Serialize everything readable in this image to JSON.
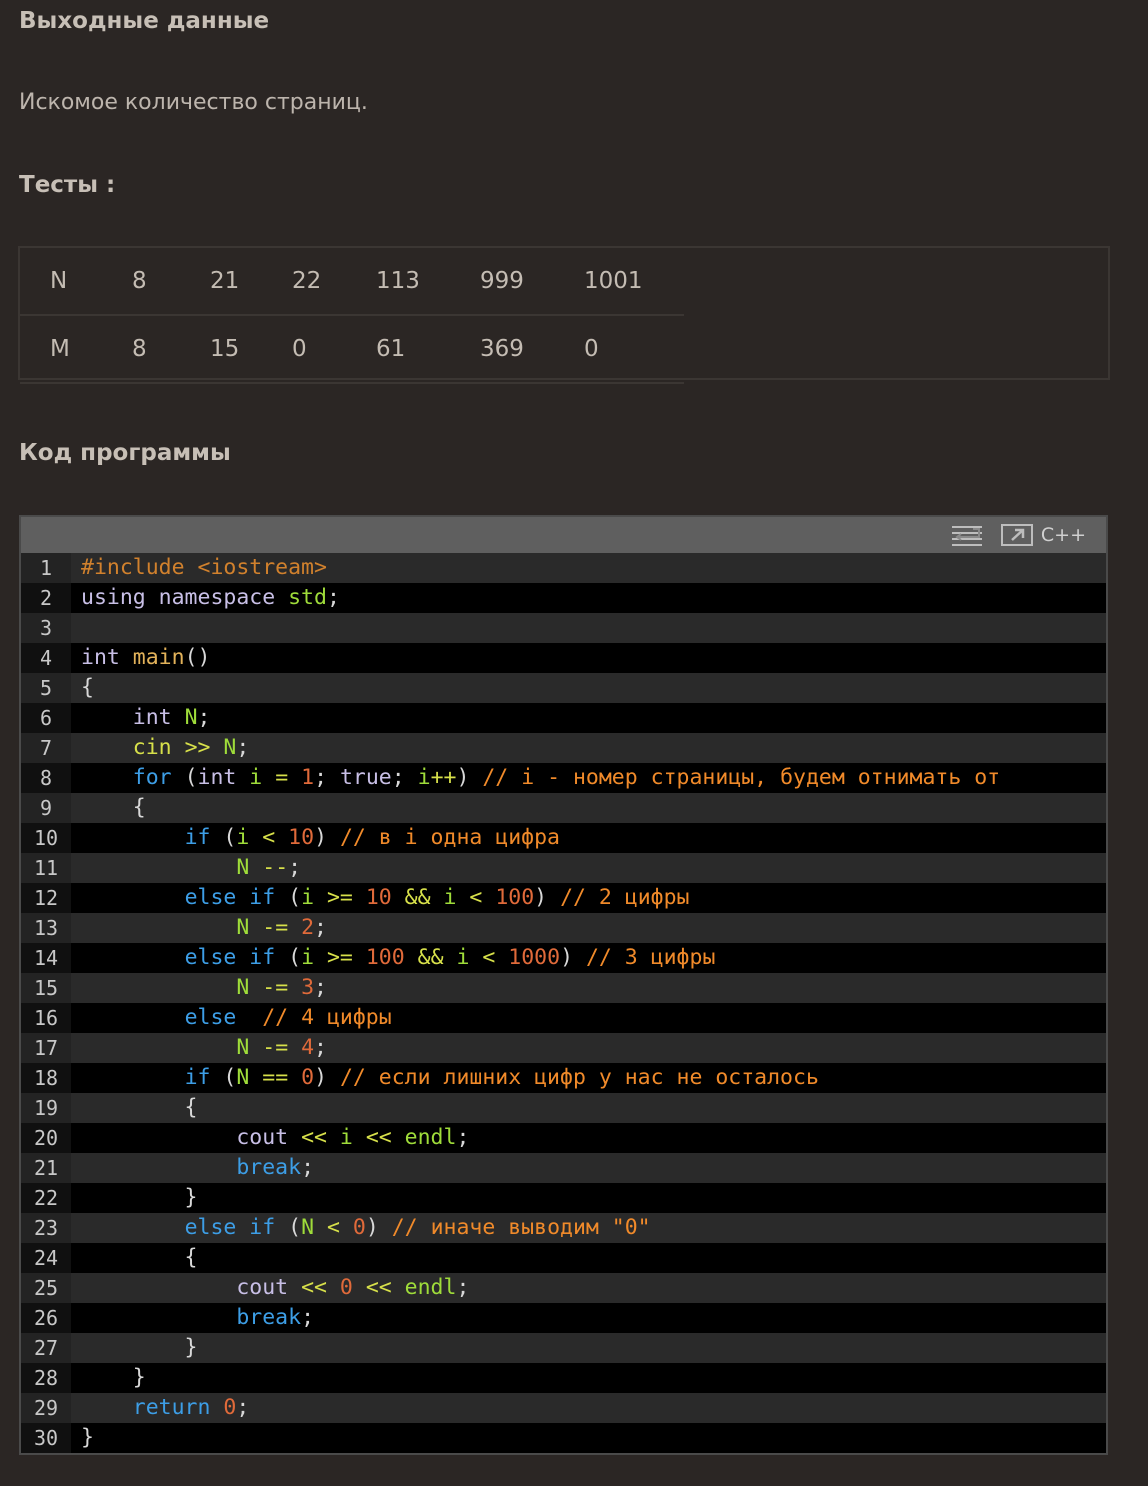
{
  "headings": {
    "output": "Выходные данные",
    "output_text": "Искомое количество страниц.",
    "tests": "Тесты :",
    "code": "Код программы"
  },
  "tests_table": {
    "rows": [
      [
        "N",
        "8",
        "21",
        "22",
        "113",
        "999",
        "1001"
      ],
      [
        "M",
        "8",
        "15",
        "0",
        "61",
        "369",
        "0"
      ]
    ]
  },
  "code_block": {
    "language": "C++",
    "toolbar_icons": [
      "wrap-lines-icon",
      "open-external-icon"
    ],
    "line_numbers": [
      "1",
      "2",
      "3",
      "4",
      "5",
      "6",
      "7",
      "8",
      "9",
      "10",
      "11",
      "12",
      "13",
      "14",
      "15",
      "16",
      "17",
      "18",
      "19",
      "20",
      "21",
      "22",
      "23",
      "24",
      "25",
      "26",
      "27",
      "28",
      "29",
      "30"
    ],
    "lines": [
      [
        [
          "pre",
          "#include <iostream>"
        ]
      ],
      [
        [
          "kw",
          "using namespace "
        ],
        [
          "id",
          "std"
        ],
        [
          "p",
          ";"
        ]
      ],
      [],
      [
        [
          "kw",
          "int "
        ],
        [
          "fn",
          "main"
        ],
        [
          "p",
          "()"
        ]
      ],
      [
        [
          "p",
          "{"
        ]
      ],
      [
        [
          "p",
          "    "
        ],
        [
          "kw",
          "int "
        ],
        [
          "id",
          "N"
        ],
        [
          "p",
          ";"
        ]
      ],
      [
        [
          "p",
          "    "
        ],
        [
          "op",
          "cin"
        ],
        [
          "p",
          " "
        ],
        [
          "op",
          ">>"
        ],
        [
          "p",
          " "
        ],
        [
          "id",
          "N"
        ],
        [
          "p",
          ";"
        ]
      ],
      [
        [
          "p",
          "    "
        ],
        [
          "flow",
          "for "
        ],
        [
          "p",
          "("
        ],
        [
          "kw",
          "int "
        ],
        [
          "id",
          "i"
        ],
        [
          "p",
          " "
        ],
        [
          "op",
          "="
        ],
        [
          "p",
          " "
        ],
        [
          "num",
          "1"
        ],
        [
          "p",
          "; "
        ],
        [
          "kw",
          "true"
        ],
        [
          "p",
          "; "
        ],
        [
          "id",
          "i"
        ],
        [
          "op",
          "++"
        ],
        [
          "p",
          ") "
        ],
        [
          "cmt",
          "// i - номер страницы, будем отнимать от"
        ]
      ],
      [
        [
          "p",
          "    {"
        ]
      ],
      [
        [
          "p",
          "        "
        ],
        [
          "flow",
          "if "
        ],
        [
          "p",
          "("
        ],
        [
          "id",
          "i"
        ],
        [
          "p",
          " "
        ],
        [
          "op",
          "<"
        ],
        [
          "p",
          " "
        ],
        [
          "num",
          "10"
        ],
        [
          "p",
          ") "
        ],
        [
          "cmt",
          "// в i одна цифра"
        ]
      ],
      [
        [
          "p",
          "            "
        ],
        [
          "id",
          "N"
        ],
        [
          "p",
          " "
        ],
        [
          "op",
          "--"
        ],
        [
          "p",
          ";"
        ]
      ],
      [
        [
          "p",
          "        "
        ],
        [
          "flow",
          "else if "
        ],
        [
          "p",
          "("
        ],
        [
          "id",
          "i"
        ],
        [
          "p",
          " "
        ],
        [
          "op",
          ">="
        ],
        [
          "p",
          " "
        ],
        [
          "num",
          "10"
        ],
        [
          "p",
          " "
        ],
        [
          "op",
          "&&"
        ],
        [
          "p",
          " "
        ],
        [
          "id",
          "i"
        ],
        [
          "p",
          " "
        ],
        [
          "op",
          "<"
        ],
        [
          "p",
          " "
        ],
        [
          "num",
          "100"
        ],
        [
          "p",
          ") "
        ],
        [
          "cmt",
          "// 2 цифры"
        ]
      ],
      [
        [
          "p",
          "            "
        ],
        [
          "id",
          "N"
        ],
        [
          "p",
          " "
        ],
        [
          "op",
          "-="
        ],
        [
          "p",
          " "
        ],
        [
          "num",
          "2"
        ],
        [
          "p",
          ";"
        ]
      ],
      [
        [
          "p",
          "        "
        ],
        [
          "flow",
          "else if "
        ],
        [
          "p",
          "("
        ],
        [
          "id",
          "i"
        ],
        [
          "p",
          " "
        ],
        [
          "op",
          ">="
        ],
        [
          "p",
          " "
        ],
        [
          "num",
          "100"
        ],
        [
          "p",
          " "
        ],
        [
          "op",
          "&&"
        ],
        [
          "p",
          " "
        ],
        [
          "id",
          "i"
        ],
        [
          "p",
          " "
        ],
        [
          "op",
          "<"
        ],
        [
          "p",
          " "
        ],
        [
          "num",
          "1000"
        ],
        [
          "p",
          ") "
        ],
        [
          "cmt",
          "// 3 цифры"
        ]
      ],
      [
        [
          "p",
          "            "
        ],
        [
          "id",
          "N"
        ],
        [
          "p",
          " "
        ],
        [
          "op",
          "-="
        ],
        [
          "p",
          " "
        ],
        [
          "num",
          "3"
        ],
        [
          "p",
          ";"
        ]
      ],
      [
        [
          "p",
          "        "
        ],
        [
          "flow",
          "else"
        ],
        [
          "p",
          "  "
        ],
        [
          "cmt",
          "// 4 цифры"
        ]
      ],
      [
        [
          "p",
          "            "
        ],
        [
          "id",
          "N"
        ],
        [
          "p",
          " "
        ],
        [
          "op",
          "-="
        ],
        [
          "p",
          " "
        ],
        [
          "num",
          "4"
        ],
        [
          "p",
          ";"
        ]
      ],
      [
        [
          "p",
          "        "
        ],
        [
          "flow",
          "if "
        ],
        [
          "p",
          "("
        ],
        [
          "id",
          "N"
        ],
        [
          "p",
          " "
        ],
        [
          "op",
          "=="
        ],
        [
          "p",
          " "
        ],
        [
          "num",
          "0"
        ],
        [
          "p",
          ") "
        ],
        [
          "cmt",
          "// если лишних цифр у нас не осталось"
        ]
      ],
      [
        [
          "p",
          "        {"
        ]
      ],
      [
        [
          "p",
          "            "
        ],
        [
          "kw",
          "cout"
        ],
        [
          "p",
          " "
        ],
        [
          "op",
          "<<"
        ],
        [
          "p",
          " "
        ],
        [
          "id",
          "i"
        ],
        [
          "p",
          " "
        ],
        [
          "op",
          "<<"
        ],
        [
          "p",
          " "
        ],
        [
          "id",
          "endl"
        ],
        [
          "p",
          ";"
        ]
      ],
      [
        [
          "p",
          "            "
        ],
        [
          "flow",
          "break"
        ],
        [
          "p",
          ";"
        ]
      ],
      [
        [
          "p",
          "        }"
        ]
      ],
      [
        [
          "p",
          "        "
        ],
        [
          "flow",
          "else if "
        ],
        [
          "p",
          "("
        ],
        [
          "id",
          "N"
        ],
        [
          "p",
          " "
        ],
        [
          "op",
          "<"
        ],
        [
          "p",
          " "
        ],
        [
          "num",
          "0"
        ],
        [
          "p",
          ") "
        ],
        [
          "cmt",
          "// иначе выводим "
        ],
        [
          "str",
          "\"0\""
        ]
      ],
      [
        [
          "p",
          "        {"
        ]
      ],
      [
        [
          "p",
          "            "
        ],
        [
          "kw",
          "cout"
        ],
        [
          "p",
          " "
        ],
        [
          "op",
          "<<"
        ],
        [
          "p",
          " "
        ],
        [
          "num",
          "0"
        ],
        [
          "p",
          " "
        ],
        [
          "op",
          "<<"
        ],
        [
          "p",
          " "
        ],
        [
          "id",
          "endl"
        ],
        [
          "p",
          ";"
        ]
      ],
      [
        [
          "p",
          "            "
        ],
        [
          "flow",
          "break"
        ],
        [
          "p",
          ";"
        ]
      ],
      [
        [
          "p",
          "        }"
        ]
      ],
      [
        [
          "p",
          "    }"
        ]
      ],
      [
        [
          "p",
          "    "
        ],
        [
          "flow",
          "return "
        ],
        [
          "num",
          "0"
        ],
        [
          "p",
          ";"
        ]
      ],
      [
        [
          "p",
          "}"
        ]
      ]
    ]
  }
}
